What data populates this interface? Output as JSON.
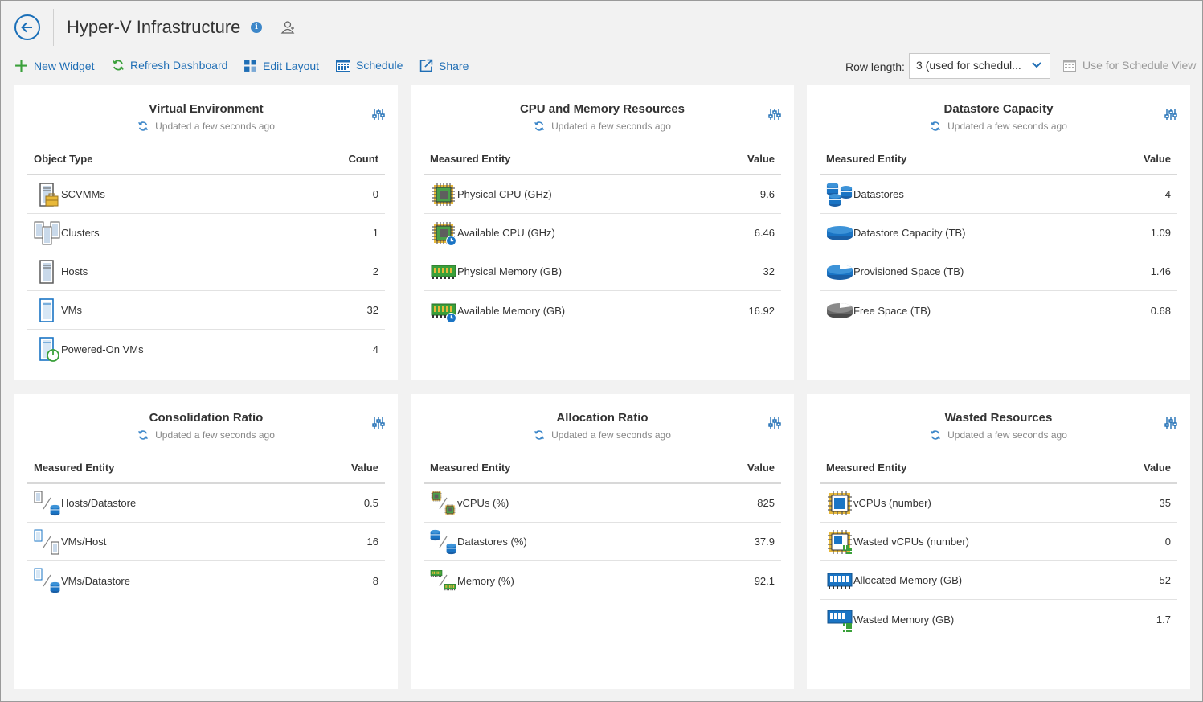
{
  "header": {
    "title": "Hyper-V Infrastructure"
  },
  "toolbar": {
    "new_widget": "New Widget",
    "refresh": "Refresh Dashboard",
    "edit_layout": "Edit Layout",
    "schedule": "Schedule",
    "share": "Share",
    "row_length_label": "Row length:",
    "row_length_value": "3 (used for schedul...",
    "schedule_view": "Use for Schedule View"
  },
  "widgets": {
    "w1": {
      "title": "Virtual Environment",
      "updated": "Updated a few seconds ago",
      "col1": "Object Type",
      "col2": "Count",
      "rows": [
        {
          "label": "SCVMMs",
          "value": "0"
        },
        {
          "label": "Clusters",
          "value": "1"
        },
        {
          "label": "Hosts",
          "value": "2"
        },
        {
          "label": "VMs",
          "value": "32"
        },
        {
          "label": "Powered-On VMs",
          "value": "4"
        }
      ]
    },
    "w2": {
      "title": "CPU and Memory Resources",
      "updated": "Updated a few seconds ago",
      "col1": "Measured Entity",
      "col2": "Value",
      "rows": [
        {
          "label": "Physical CPU (GHz)",
          "value": "9.6"
        },
        {
          "label": "Available CPU (GHz)",
          "value": "6.46"
        },
        {
          "label": "Physical Memory (GB)",
          "value": "32"
        },
        {
          "label": "Available Memory (GB)",
          "value": "16.92"
        }
      ]
    },
    "w3": {
      "title": "Datastore Capacity",
      "updated": "Updated a few seconds ago",
      "col1": "Measured Entity",
      "col2": "Value",
      "rows": [
        {
          "label": "Datastores",
          "value": "4"
        },
        {
          "label": "Datastore Capacity (TB)",
          "value": "1.09"
        },
        {
          "label": "Provisioned Space (TB)",
          "value": "1.46"
        },
        {
          "label": "Free Space (TB)",
          "value": "0.68"
        }
      ]
    },
    "w4": {
      "title": "Consolidation Ratio",
      "updated": "Updated a few seconds ago",
      "col1": "Measured Entity",
      "col2": "Value",
      "rows": [
        {
          "label": "Hosts/Datastore",
          "value": "0.5"
        },
        {
          "label": "VMs/Host",
          "value": "16"
        },
        {
          "label": "VMs/Datastore",
          "value": "8"
        }
      ]
    },
    "w5": {
      "title": "Allocation Ratio",
      "updated": "Updated a few seconds ago",
      "col1": "Measured Entity",
      "col2": "Value",
      "rows": [
        {
          "label": "vCPUs (%)",
          "value": "825"
        },
        {
          "label": "Datastores (%)",
          "value": "37.9"
        },
        {
          "label": "Memory (%)",
          "value": "92.1"
        }
      ]
    },
    "w6": {
      "title": "Wasted Resources",
      "updated": "Updated a few seconds ago",
      "col1": "Measured Entity",
      "col2": "Value",
      "rows": [
        {
          "label": "vCPUs (number)",
          "value": "35"
        },
        {
          "label": "Wasted vCPUs (number)",
          "value": "0"
        },
        {
          "label": "Allocated Memory (GB)",
          "value": "52"
        },
        {
          "label": "Wasted Memory (GB)",
          "value": "1.7"
        }
      ]
    }
  },
  "colors": {
    "accent": "#1f6eb5",
    "green": "#3aa03a",
    "icon_blue": "#1a74c4",
    "icon_yellow": "#e8b93a"
  }
}
